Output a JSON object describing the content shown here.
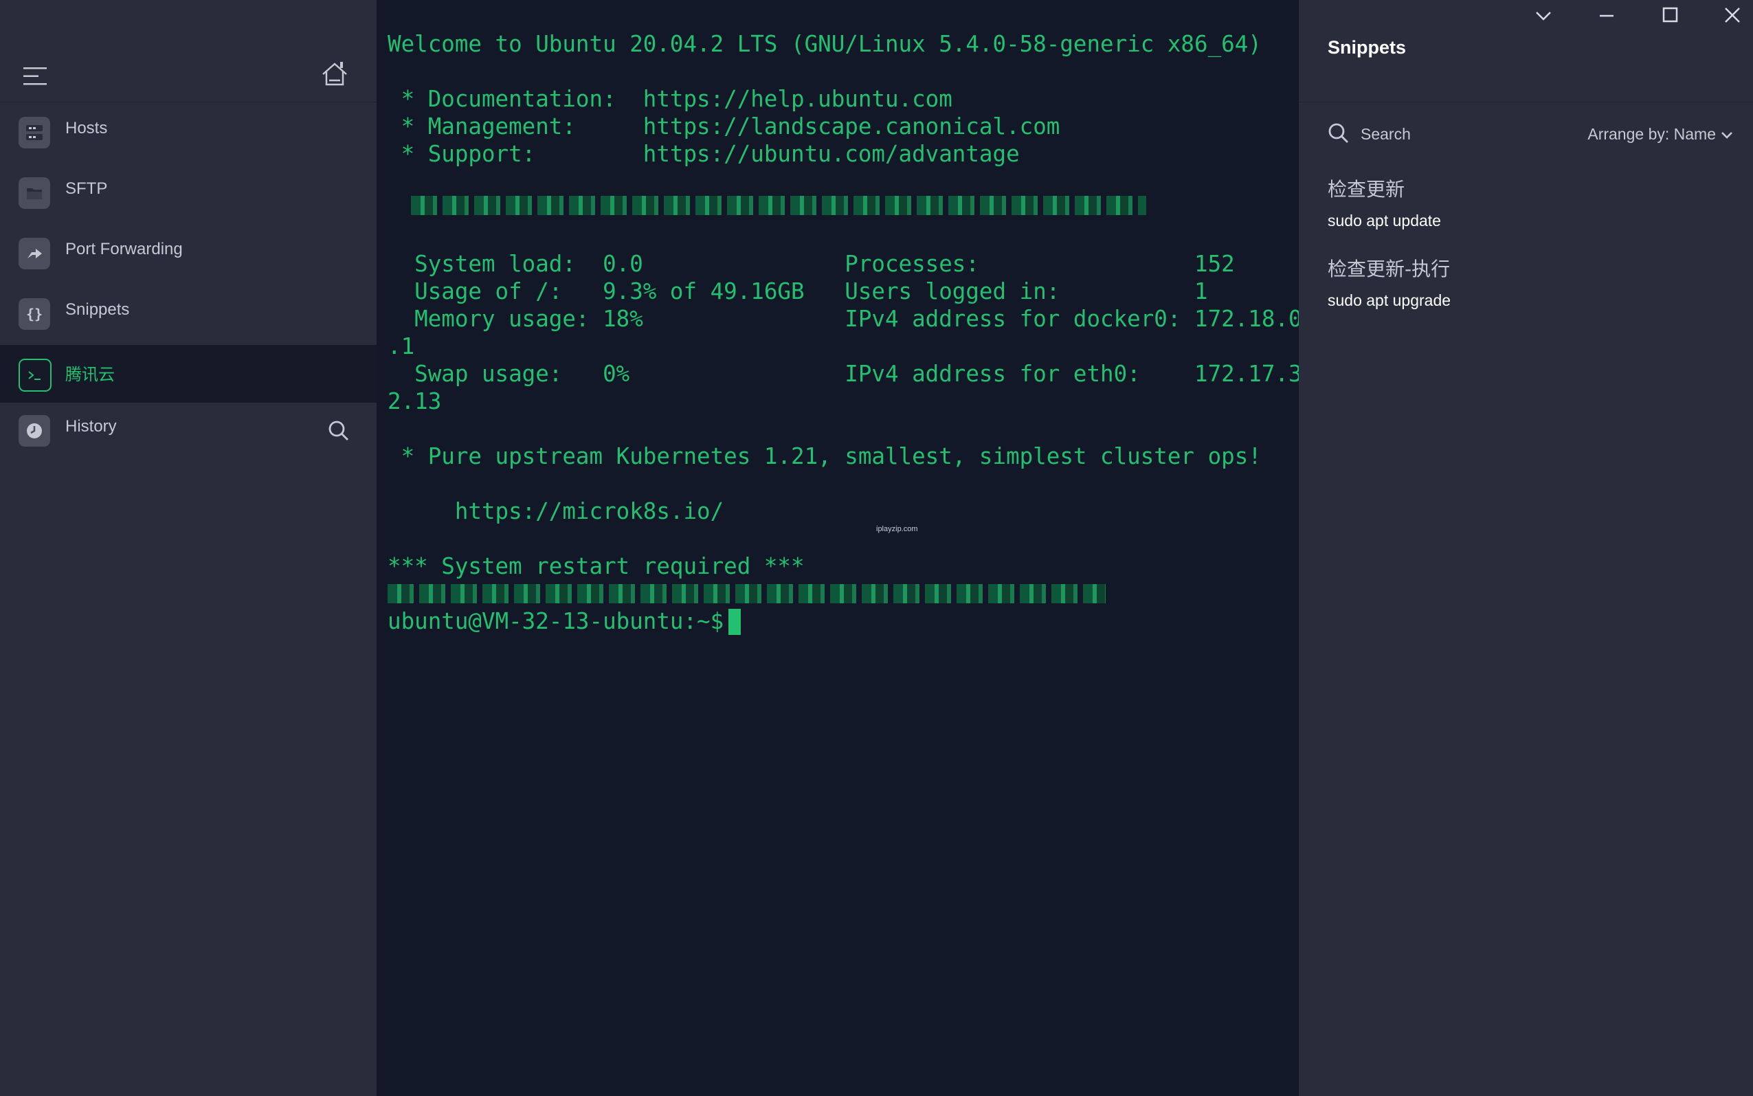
{
  "sidebar": {
    "items": [
      {
        "label": "Hosts",
        "icon": "hosts-icon"
      },
      {
        "label": "SFTP",
        "icon": "folder-icon"
      },
      {
        "label": "Port Forwarding",
        "icon": "port-forwarding-icon"
      },
      {
        "label": "Snippets",
        "icon": "braces-icon"
      },
      {
        "label": "腾讯云",
        "icon": "terminal-icon",
        "active": true
      },
      {
        "label": "History",
        "icon": "clock-icon"
      }
    ]
  },
  "terminal": {
    "lines": [
      "Welcome to Ubuntu 20.04.2 LTS (GNU/Linux 5.4.0-58-generic x86_64)",
      " * Documentation:  https://help.ubuntu.com",
      " * Management:     https://landscape.canonical.com",
      " * Support:        https://ubuntu.com/advantage",
      "  System load:  0.0               Processes:                152",
      "  Usage of /:   9.3% of 49.16GB   Users logged in:          1",
      "  Memory usage: 18%               IPv4 address for docker0: 172.18.0",
      ".1",
      "  Swap usage:   0%                IPv4 address for eth0:    172.17.3",
      "2.13",
      " * Pure upstream Kubernetes 1.21, smallest, simplest cluster ops!",
      "     https://microk8s.io/",
      "*** System restart required ***",
      "ubuntu@VM-32-13-ubuntu:~$ "
    ],
    "watermark": "iplayzip.com"
  },
  "snippets": {
    "title": "Snippets",
    "search_placeholder": "Search",
    "arrange_label": "Arrange by: Name",
    "items": [
      {
        "name": "检查更新",
        "command": "sudo apt update"
      },
      {
        "name": "检查更新-执行",
        "command": "sudo apt upgrade"
      }
    ]
  },
  "colors": {
    "accent": "#22c06f",
    "sidebar_bg": "#292c3a",
    "terminal_bg": "#131828"
  }
}
